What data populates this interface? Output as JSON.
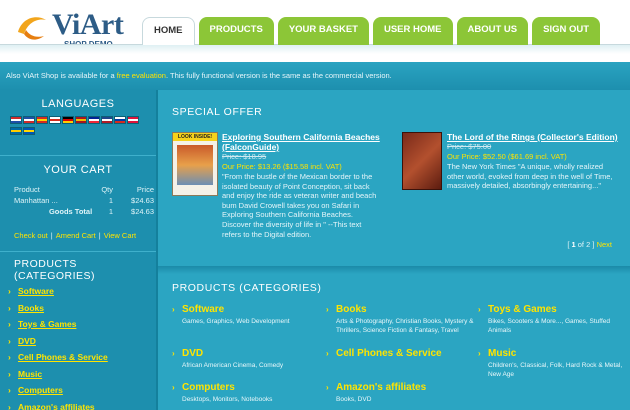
{
  "header": {
    "logo_text": "ViArt",
    "logo_sub": "SHOP DEMO",
    "nav": [
      "HOME",
      "PRODUCTS",
      "YOUR BASKET",
      "USER HOME",
      "ABOUT US",
      "SIGN OUT"
    ],
    "active_tab": "HOME"
  },
  "infobar": {
    "prefix": "Also ViArt Shop is available for a",
    "link": "free evaluation",
    "suffix": ". This fully functional version is the same as the commercial version."
  },
  "sidebar": {
    "languages_title": "LANGUAGES",
    "flags": [
      [
        "#cf2b2b",
        "#ffffff",
        "#1e4fa8"
      ],
      [
        "#1e4fa8",
        "#ffffff",
        "#cf2b2b"
      ],
      [
        "#d52b1e",
        "#ffd700",
        "#d52b1e"
      ],
      [
        "#ffffff",
        "#d52b1e",
        "#ffffff"
      ],
      [
        "#000000",
        "#dd0000",
        "#ffce00"
      ],
      [
        "#aa151b",
        "#f1bf00",
        "#aa151b"
      ],
      [
        "#002395",
        "#ffffff",
        "#ed2939"
      ],
      [
        "#21468b",
        "#ffffff",
        "#ae1c28"
      ],
      [
        "#ffffff",
        "#0039a6",
        "#d52b1e"
      ],
      [
        "#dc143c",
        "#ffffff",
        "#dc143c"
      ],
      [
        "#006aa7",
        "#fecc00",
        "#006aa7"
      ],
      [
        "#0057b7",
        "#ffd700",
        "#0057b7"
      ]
    ],
    "cart_title": "YOUR CART",
    "cart_headers": {
      "product": "Product",
      "qty": "Qty",
      "price": "Price"
    },
    "cart_rows": [
      {
        "product": "Manhattan ...",
        "qty": "1",
        "price": "$24.63"
      }
    ],
    "goods_total_label": "Goods Total",
    "goods_total_qty": "1",
    "goods_total_price": "$24.63",
    "cart_links": [
      "Check out",
      "Amend Cart",
      "View Cart"
    ],
    "categories_title": "PRODUCTS (CATEGORIES)",
    "categories": [
      "Software",
      "Books",
      "Toys & Games",
      "DVD",
      "Cell Phones & Service",
      "Music",
      "Computers",
      "Amazon's affiliates"
    ]
  },
  "special_offer": {
    "title": "SPECIAL OFFER",
    "items": [
      {
        "title": "Exploring Southern California Beaches (FalconGuide)",
        "old_price": "Price: $18.95",
        "our_price": "Our Price: $13.26 ($15.58 incl. VAT)",
        "description": "\"From the bustle of the Mexican border to the isolated beauty of Point Conception, sit back and enjoy the ride as veteran writer and beach bum David Crowell takes you on Safari in Exploring Southern California Beaches. Discover the diversity of life in \" --This text refers to the Digital edition.",
        "cover_label": "LOOK INSIDE!"
      },
      {
        "title": "The Lord of the Rings (Collector's Edition)",
        "old_price": "Price: $75.00",
        "our_price": "Our Price: $52.50 ($61.69 incl. VAT)",
        "description": "The New York Times \"A unique, wholly realized other world, evoked from deep in the well of Time, massively detailed, absorbingly entertaining...\""
      }
    ],
    "pager": {
      "open": "[",
      "current": "1",
      "of": "of",
      "total": "2",
      "close": "]",
      "next": "Next"
    }
  },
  "products_grid": {
    "title": "PRODUCTS (CATEGORIES)",
    "items": [
      {
        "name": "Software",
        "sub": "Games, Graphics, Web Development"
      },
      {
        "name": "Books",
        "sub": "Arts & Photography, Christian Books, Mystery & Thrillers, Science Fiction & Fantasy, Travel"
      },
      {
        "name": "Toys & Games",
        "sub": "Bikes, Scooters & More..., Games, Stuffed Animals"
      },
      {
        "name": "DVD",
        "sub": "African American Cinema, Comedy"
      },
      {
        "name": "Cell Phones & Service",
        "sub": ""
      },
      {
        "name": "Music",
        "sub": "Children's, Classical, Folk, Hard Rock & Metal, New Age"
      },
      {
        "name": "Computers",
        "sub": "Desktops, Monitors, Notebooks"
      },
      {
        "name": "Amazon's affiliates",
        "sub": "Books, DVD"
      }
    ]
  },
  "colors": {
    "accent_green": "#8cc637",
    "teal": "#2ba5c2",
    "dark_teal": "#1d8fae",
    "link_yellow": "#ffe400"
  }
}
